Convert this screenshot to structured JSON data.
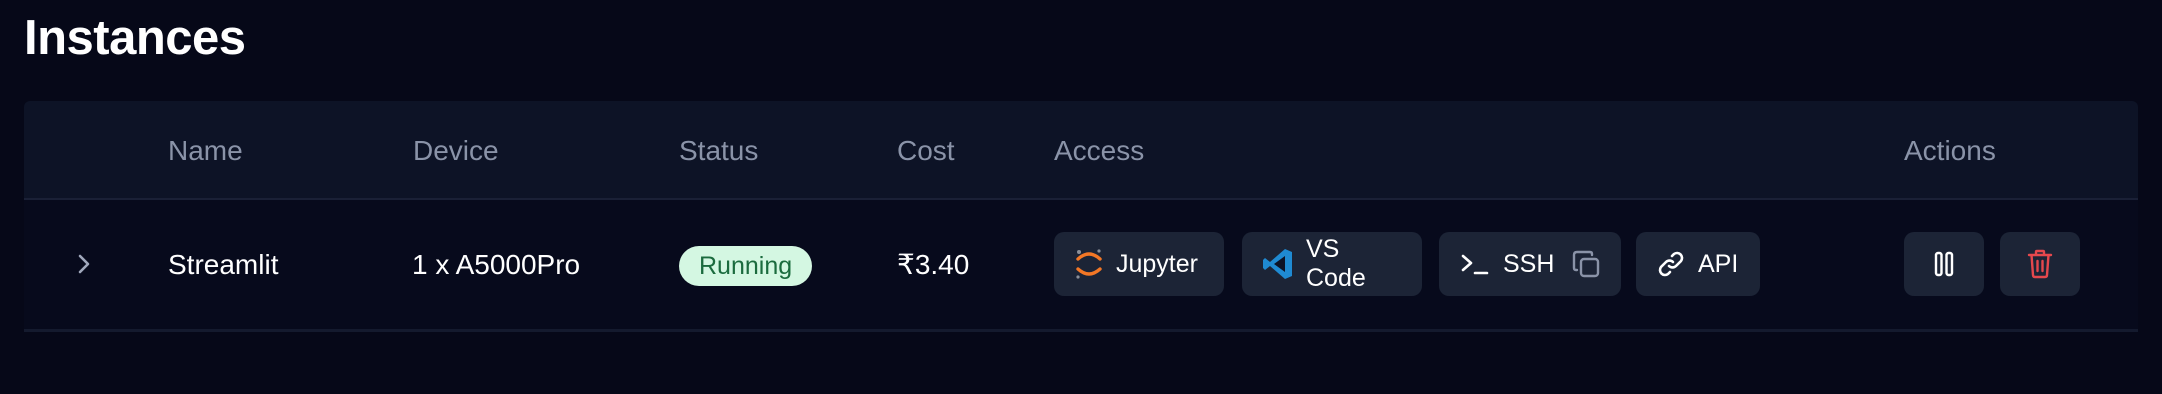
{
  "page": {
    "title": "Instances"
  },
  "table": {
    "headers": {
      "name": "Name",
      "device": "Device",
      "status": "Status",
      "cost": "Cost",
      "access": "Access",
      "actions": "Actions"
    },
    "rows": [
      {
        "name": "Streamlit",
        "device": "1 x A5000Pro",
        "status": "Running",
        "cost": "₹3.40",
        "access": {
          "jupyter": "Jupyter",
          "vscode": "VS Code",
          "ssh": "SSH",
          "api": "API"
        }
      }
    ]
  },
  "icons": {
    "expand": "chevron-right-icon",
    "jupyter": "jupyter-icon",
    "vscode": "vscode-icon",
    "ssh": "terminal-icon",
    "copy": "copy-icon",
    "api": "link-icon",
    "pause": "pause-icon",
    "delete": "trash-icon"
  },
  "colors": {
    "background": "#060818",
    "header_bg": "#0d1326",
    "button_bg": "#1c2436",
    "status_bg": "#d4f7e2",
    "status_text": "#1b6b3e",
    "jupyter_orange": "#f37726",
    "vscode_blue": "#1f8ad2",
    "delete_red": "#e5484d"
  }
}
